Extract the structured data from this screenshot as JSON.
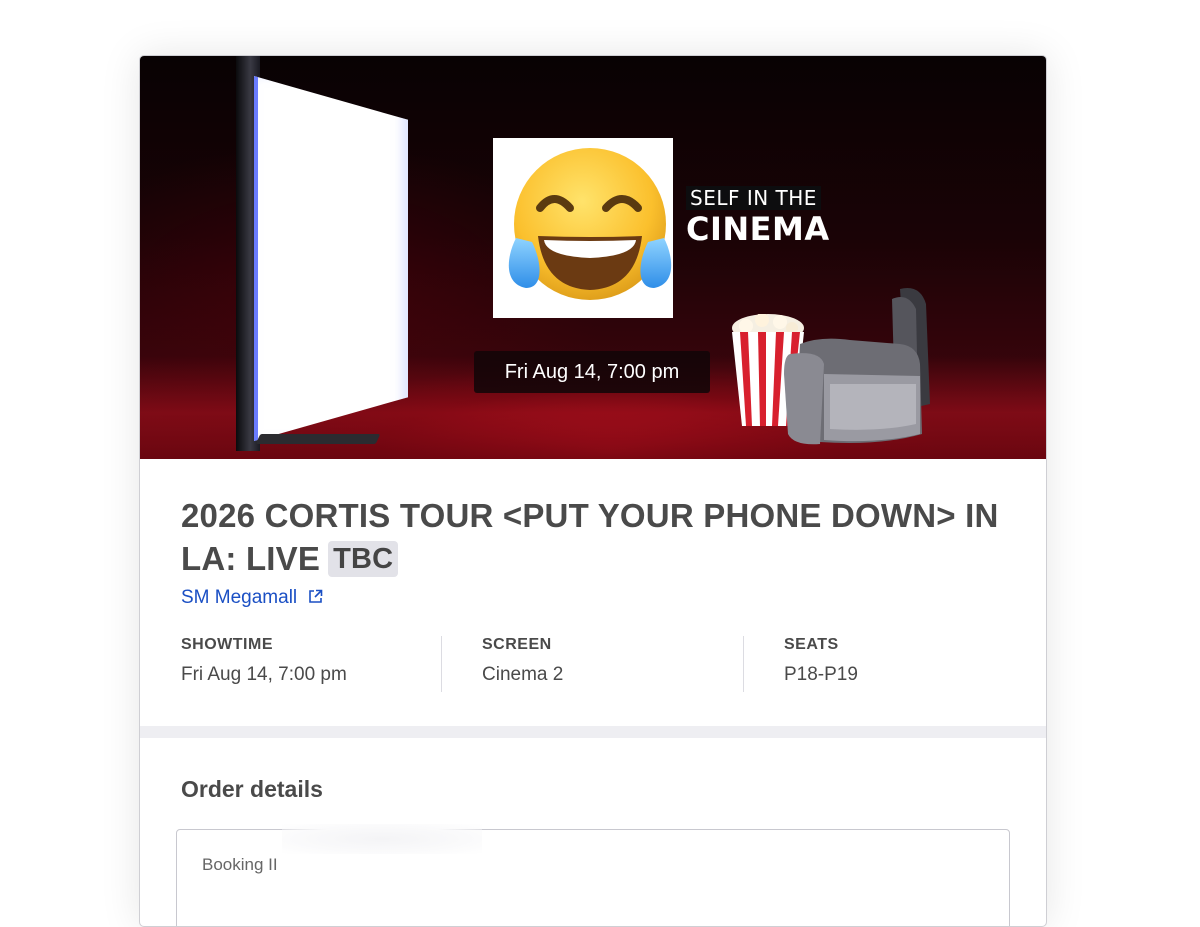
{
  "banner": {
    "tagline_top": "SELF IN THE",
    "tagline_big": "CINEMA",
    "date_pill": "Fri Aug 14, 7:00 pm"
  },
  "event": {
    "title": "2026 CORTIS TOUR <PUT YOUR PHONE DOWN> IN LA: LIVE",
    "badge": "TBC"
  },
  "venue": {
    "label": "SM Megamall"
  },
  "stats": [
    {
      "label": "SHOWTIME",
      "value": "Fri Aug 14, 7:00 pm"
    },
    {
      "label": "SCREEN",
      "value": "Cinema 2"
    },
    {
      "label": "SEATS",
      "value": "P18-P19"
    }
  ],
  "order": {
    "title": "Order details",
    "booking_label": "Booking II"
  },
  "colors": {
    "link": "#1a4fc4",
    "badge_bg": "#e2e2e8",
    "banner_red": "#b3101f"
  },
  "icons": {
    "venue_link": "external-link-icon",
    "sticker": "face-with-tears-of-joy-emoji"
  }
}
